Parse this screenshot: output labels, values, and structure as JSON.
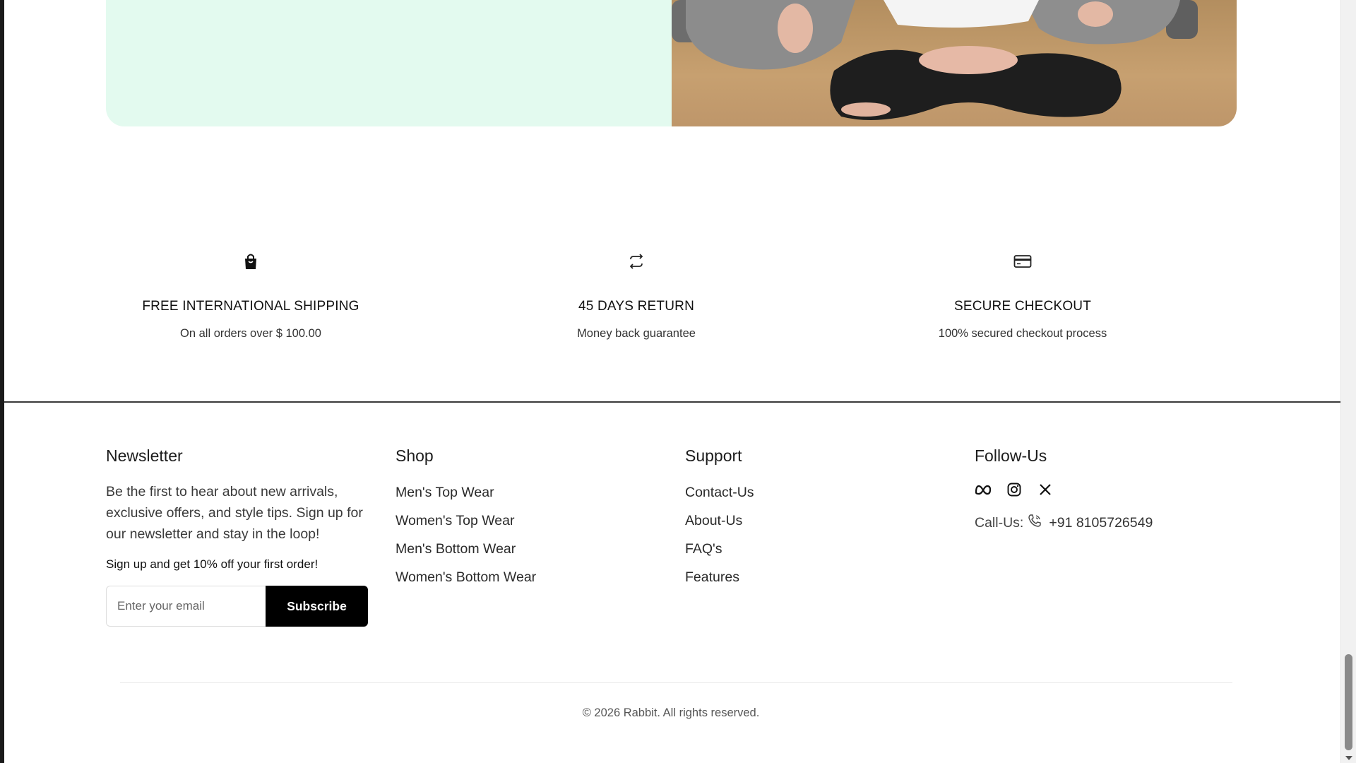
{
  "features": [
    {
      "icon": "shopping-bag-icon",
      "title": "FREE INTERNATIONAL SHIPPING",
      "subtitle": "On all orders over $ 100.00"
    },
    {
      "icon": "return-cycle-icon",
      "title": "45 DAYS RETURN",
      "subtitle": "Money back guarantee"
    },
    {
      "icon": "credit-card-icon",
      "title": "SECURE CHECKOUT",
      "subtitle": "100% secured checkout process"
    }
  ],
  "footer": {
    "newsletter": {
      "heading": "Newsletter",
      "description": "Be the first to hear about new arrivals, exclusive offers, and style tips. Sign up for our newsletter and stay in the loop!",
      "promo": "Sign up and get 10% off your first order!",
      "email_placeholder": "Enter your email",
      "button_label": "Subscribe"
    },
    "shop": {
      "heading": "Shop",
      "links": [
        "Men's Top Wear",
        "Women's Top Wear",
        "Men's Bottom Wear",
        "Women's Bottom Wear"
      ]
    },
    "support": {
      "heading": "Support",
      "links": [
        "Contact-Us",
        "About-Us",
        "FAQ's",
        "Features"
      ]
    },
    "follow": {
      "heading": "Follow-Us",
      "social_icons": [
        "meta-icon",
        "instagram-icon",
        "x-icon"
      ],
      "call_label": "Call-Us:",
      "phone": "+91 8105726549"
    },
    "copyright": "© 2026 Rabbit. All rights reserved."
  },
  "colors": {
    "hero_panel": "#e3faef",
    "button_bg": "#000000",
    "text": "#1f1f1f"
  }
}
